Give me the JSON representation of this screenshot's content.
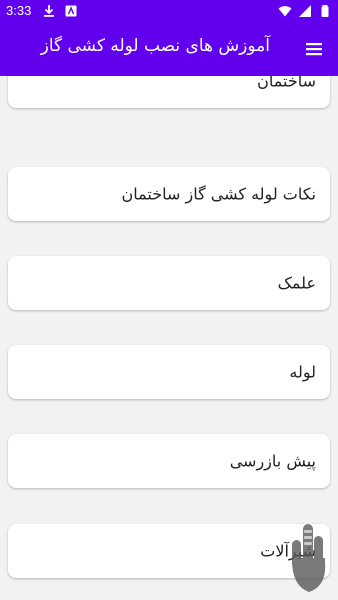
{
  "status_bar": {
    "time": "3:33",
    "left_icons": [
      "download-icon",
      "news-icon"
    ],
    "right_icons": [
      "wifi-icon",
      "signal-icon",
      "battery-icon"
    ]
  },
  "app_bar": {
    "title": "آموزش های نصب لوله کشی گاز",
    "menu_icon": "hamburger-menu-icon",
    "background": "#6200ee"
  },
  "items": [
    {
      "label": "ساختمان"
    },
    {
      "label": "نکات لوله کشی گاز ساختمان"
    },
    {
      "label": "علمک"
    },
    {
      "label": "لوله"
    },
    {
      "label": "پیش بازرسی"
    },
    {
      "label": "شیرآلات"
    }
  ]
}
